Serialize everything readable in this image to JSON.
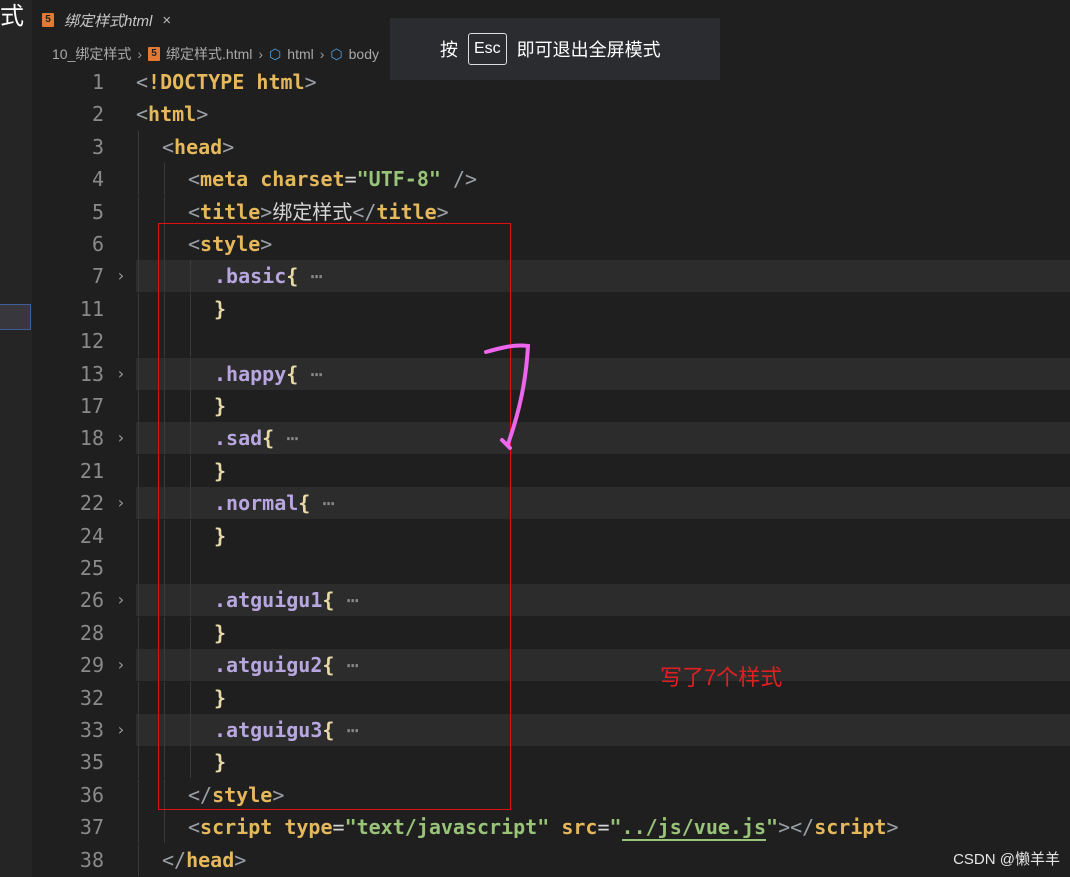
{
  "left_fragment": "式",
  "tab": {
    "icon": "html5-icon",
    "title": "绑定样式html",
    "close": "×"
  },
  "breadcrumb": [
    "10_绑定样式",
    "绑定样式.html",
    "html",
    "body"
  ],
  "overlay": {
    "press": "按",
    "key": "Esc",
    "text": "即可退出全屏模式"
  },
  "lines": [
    {
      "n": "1",
      "ind": 0,
      "html": "<span class='p'>&lt;</span><span class='t'>!DOCTYPE html</span><span class='p'>&gt;</span>"
    },
    {
      "n": "2",
      "ind": 0,
      "html": "<span class='p'>&lt;</span><span class='t'>html</span><span class='p'>&gt;</span>"
    },
    {
      "n": "3",
      "ind": 1,
      "html": "<span class='p'>&lt;</span><span class='t'>head</span><span class='p'>&gt;</span>"
    },
    {
      "n": "4",
      "ind": 2,
      "html": "<span class='p'>&lt;</span><span class='t'>meta</span> <span class='a'>charset</span><span class='w'>=</span><span class='s'>\"UTF-8\"</span> <span class='p'>/&gt;</span>"
    },
    {
      "n": "5",
      "ind": 2,
      "html": "<span class='p'>&lt;</span><span class='t'>title</span><span class='p'>&gt;</span><span class='w'>绑定样式</span><span class='p'>&lt;/</span><span class='t'>title</span><span class='p'>&gt;</span>"
    },
    {
      "n": "6",
      "ind": 2,
      "html": "<span class='p'>&lt;</span><span class='t'>style</span><span class='p'>&gt;</span>"
    },
    {
      "n": "7",
      "ind": 3,
      "fold": true,
      "html": "<span class='c'>.basic</span><span class='b'>{</span> <span class='dots'>⋯</span>"
    },
    {
      "n": "11",
      "ind": 3,
      "html": "<span class='b'>}</span>"
    },
    {
      "n": "12",
      "ind": 3,
      "html": ""
    },
    {
      "n": "13",
      "ind": 3,
      "fold": true,
      "html": "<span class='c'>.happy</span><span class='b'>{</span> <span class='dots'>⋯</span>"
    },
    {
      "n": "17",
      "ind": 3,
      "html": "<span class='b'>}</span>"
    },
    {
      "n": "18",
      "ind": 3,
      "fold": true,
      "html": "<span class='c'>.sad</span><span class='b'>{</span> <span class='dots'>⋯</span>"
    },
    {
      "n": "21",
      "ind": 3,
      "html": "<span class='b'>}</span>"
    },
    {
      "n": "22",
      "ind": 3,
      "fold": true,
      "html": "<span class='c'>.normal</span><span class='b'>{</span> <span class='dots'>⋯</span>"
    },
    {
      "n": "24",
      "ind": 3,
      "html": "<span class='b'>}</span>"
    },
    {
      "n": "25",
      "ind": 3,
      "html": ""
    },
    {
      "n": "26",
      "ind": 3,
      "fold": true,
      "html": "<span class='c'>.atguigu1</span><span class='b'>{</span> <span class='dots'>⋯</span>"
    },
    {
      "n": "28",
      "ind": 3,
      "html": "<span class='b'>}</span>"
    },
    {
      "n": "29",
      "ind": 3,
      "fold": true,
      "html": "<span class='c'>.atguigu2</span><span class='b'>{</span> <span class='dots'>⋯</span>"
    },
    {
      "n": "32",
      "ind": 3,
      "html": "<span class='b'>}</span>"
    },
    {
      "n": "33",
      "ind": 3,
      "fold": true,
      "html": "<span class='c'>.atguigu3</span><span class='b'>{</span> <span class='dots'>⋯</span>"
    },
    {
      "n": "35",
      "ind": 3,
      "html": "<span class='b'>}</span>"
    },
    {
      "n": "36",
      "ind": 2,
      "html": "<span class='p'>&lt;/</span><span class='t'>style</span><span class='p'>&gt;</span>"
    },
    {
      "n": "37",
      "ind": 2,
      "html": "<span class='p'>&lt;</span><span class='t'>script</span> <span class='a'>type</span><span class='w'>=</span><span class='s'>\"text/javascript\"</span> <span class='a'>src</span><span class='w'>=</span><span class='s'>\"<span class='u'>../js/vue.js</span>\"</span><span class='p'>&gt;&lt;/</span><span class='t'>script</span><span class='p'>&gt;</span>"
    },
    {
      "n": "38",
      "ind": 1,
      "html": "<span class='p'>&lt;/</span><span class='t'>head</span><span class='p'>&gt;</span>"
    }
  ],
  "annotation": {
    "handwritten": "7",
    "note": "写了7个样式",
    "color": "#e02020"
  },
  "watermark": "CSDN @懒羊羊"
}
